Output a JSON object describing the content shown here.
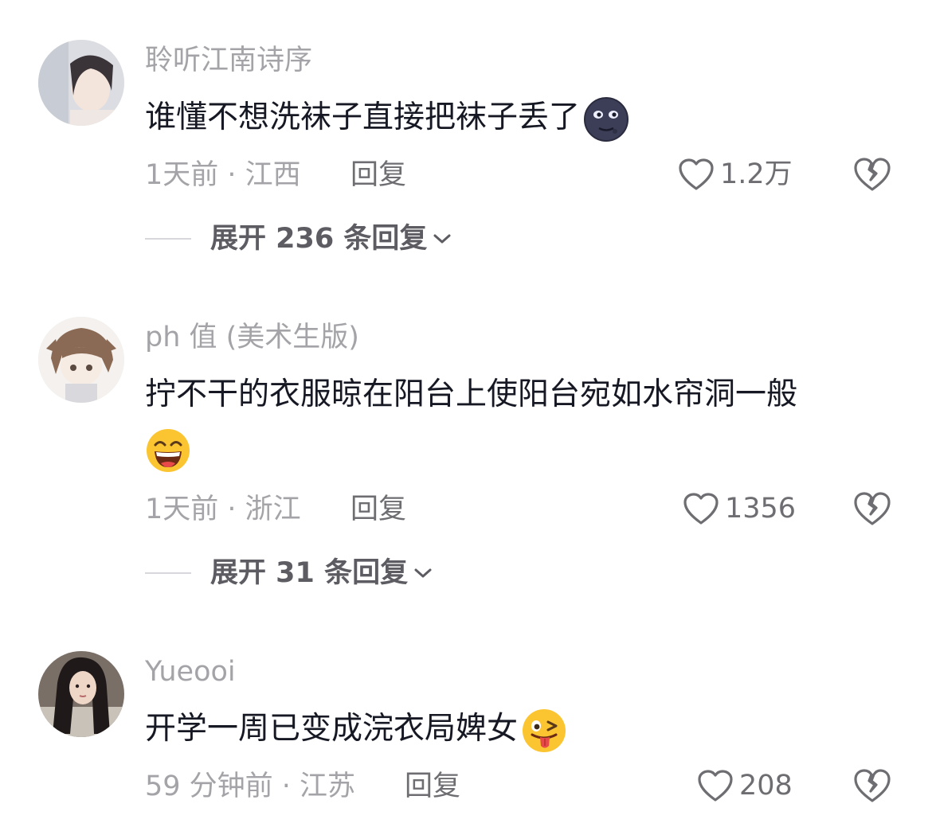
{
  "comments": [
    {
      "username": "聆听江南诗序",
      "text_lines": [
        "谁懂不想洗袜子直接把袜子丢了"
      ],
      "emoji": "new-moon-face-emoji",
      "meta": "1天前 · 江西",
      "reply_label": "回复",
      "likes": "1.2万",
      "expand_label": "展开 236 条回复"
    },
    {
      "username": "ph 值 (美术生版)",
      "text_lines": [
        "拧不干的衣服晾在阳台上使阳台宛如水帘洞一般",
        ""
      ],
      "emoji": "grinning-squinting-face-emoji",
      "meta": "1天前 · 浙江",
      "reply_label": "回复",
      "likes": "1356",
      "expand_label": "展开 31 条回复"
    },
    {
      "username": "Yueooi",
      "text_lines": [
        "开学一周已变成浣衣局婢女"
      ],
      "emoji": "winking-face-with-tongue-emoji",
      "meta": "59 分钟前 · 江苏",
      "reply_label": "回复",
      "likes": "208"
    }
  ],
  "colors": {
    "username": "#a4a4a8",
    "text": "#161823",
    "meta": "#a4a4a8",
    "action": "#6e6e72",
    "expand": "#5c5c62"
  },
  "icons": {
    "like": "heart-outline-icon",
    "dislike": "broken-heart-outline-icon",
    "expand": "chevron-down-icon"
  }
}
